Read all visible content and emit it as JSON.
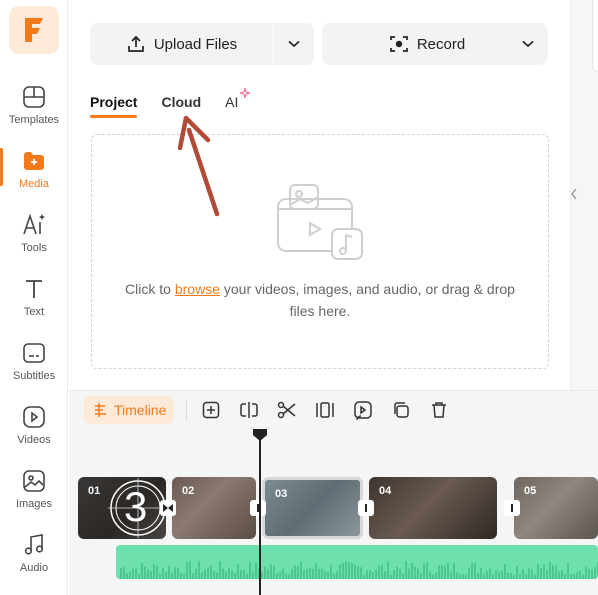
{
  "app": {
    "brand_color": "#f27a1a",
    "logo_icon": "filmora-f-logo"
  },
  "sidebar": {
    "items": [
      {
        "label": "Templates",
        "icon": "templates-icon",
        "active": false
      },
      {
        "label": "Media",
        "icon": "media-icon",
        "active": true
      },
      {
        "label": "Tools",
        "icon": "ai-tools-icon",
        "active": false
      },
      {
        "label": "Text",
        "icon": "text-icon",
        "active": false
      },
      {
        "label": "Subtitles",
        "icon": "subtitles-icon",
        "active": false
      },
      {
        "label": "Videos",
        "icon": "videos-icon",
        "active": false
      },
      {
        "label": "Images",
        "icon": "images-icon",
        "active": false
      },
      {
        "label": "Audio",
        "icon": "audio-icon",
        "active": false
      }
    ]
  },
  "top": {
    "upload_label": "Upload Files",
    "record_label": "Record"
  },
  "tabs": [
    {
      "label": "Project",
      "active": true
    },
    {
      "label": "Cloud",
      "active": false
    },
    {
      "label": "AI",
      "active": false
    }
  ],
  "dropzone": {
    "text_before": "Click to ",
    "browse": "browse",
    "text_after": " your videos, images, and audio, or drag & drop files here."
  },
  "timeline": {
    "button_label": "Timeline",
    "tools": [
      "add-icon",
      "split-icon",
      "cut-icon",
      "trim-icon",
      "replace-icon",
      "duplicate-icon",
      "delete-icon"
    ],
    "clips": [
      {
        "num": "01",
        "overlay_text": "3"
      },
      {
        "num": "02"
      },
      {
        "num": "03"
      },
      {
        "num": "04"
      },
      {
        "num": "05"
      }
    ]
  }
}
